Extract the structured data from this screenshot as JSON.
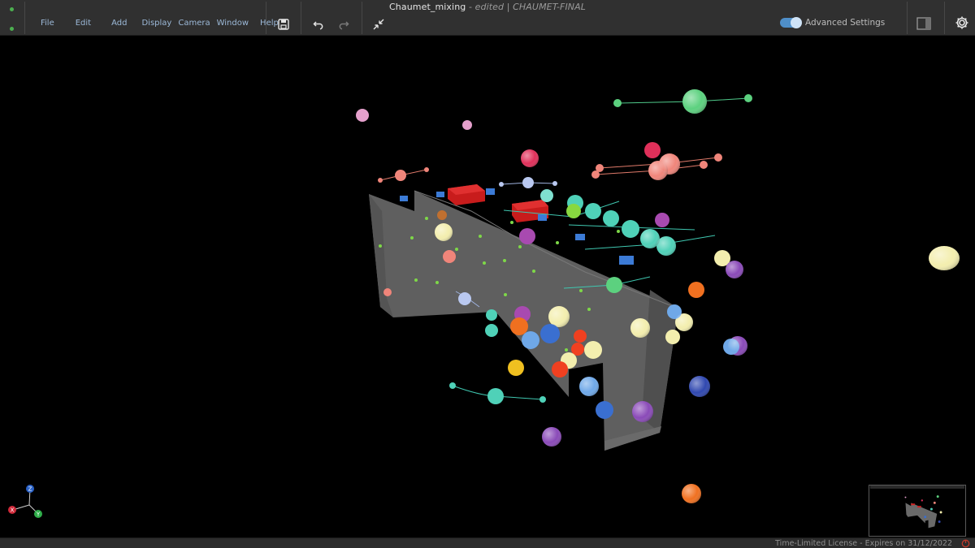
{
  "window": {
    "project_name": "Chaumet_mixing",
    "status": "- edited",
    "separator": "|",
    "session_name": "CHAUMET-FINAL"
  },
  "menu": {
    "items": [
      "File",
      "Edit",
      "Add",
      "Display",
      "Camera",
      "Window",
      "Help"
    ]
  },
  "toolbar": {
    "icons": [
      "save-icon",
      "undo-icon",
      "redo-icon",
      "collapse-icon"
    ],
    "advanced_settings_label": "Advanced Settings",
    "advanced_settings_enabled": true
  },
  "axes": {
    "x": "X",
    "y": "Y",
    "z": "Z"
  },
  "status_bar": {
    "license_text": "Time-Limited License - Expires on 31/12/2022"
  },
  "colors": {
    "accent": "#4f8fc9",
    "menu_text": "#9cb9d8",
    "toolbar_bg": "#303030",
    "viewport_bg": "#000000",
    "wall": "#5f5f5f",
    "speaker": "#d42020",
    "license_icon": "#c0392b"
  }
}
